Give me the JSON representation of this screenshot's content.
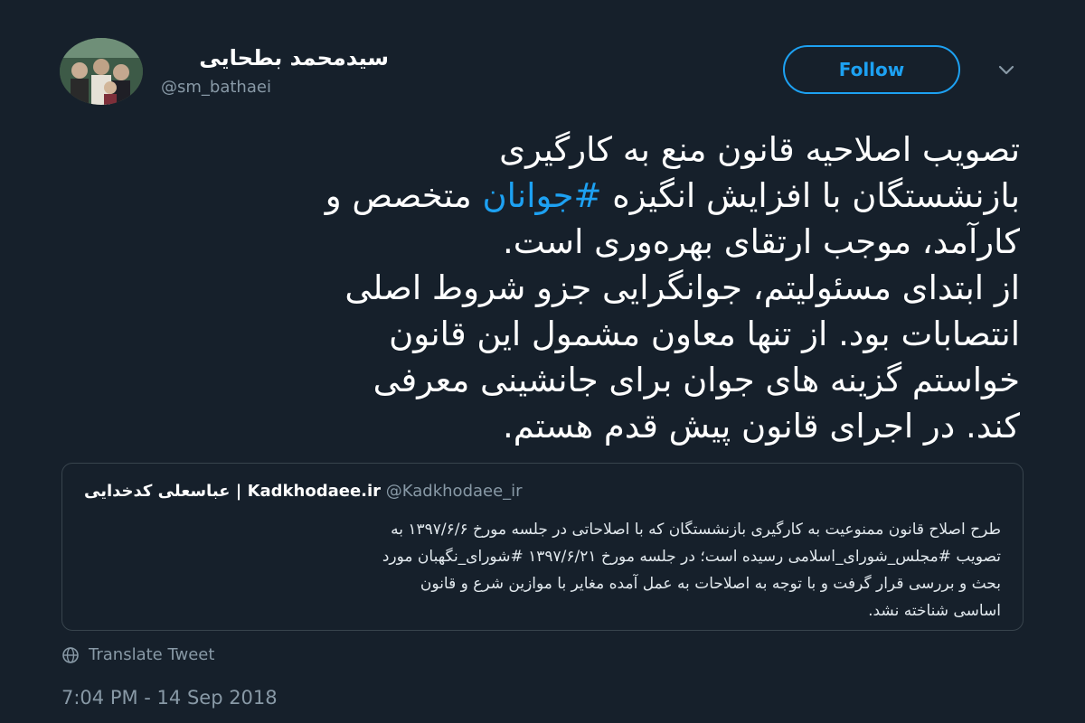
{
  "author": {
    "display_name": "سیدمحمد بطحایی",
    "handle": "@sm_bathaei"
  },
  "follow_label": "Follow",
  "tweet": {
    "lines": [
      "تصویب اصلاحیه قانون منع به کارگیری",
      {
        "before": "بازنشستگان با افزایش انگیزه ",
        "hashtag": "#جوانان",
        "after": " متخصص و"
      },
      "کارآمد، موجب ارتقای بهره‌وری است.",
      "از ابتدای مسئولیتم، جوانگرایی جزو شروط اصلی",
      "انتصابات بود. از تنها معاون مشمول این قانون",
      "خواستم گزینه های جوان برای جانشینی معرفی",
      "کند. در اجرای قانون پیش قدم هستم."
    ]
  },
  "quoted_tweet": {
    "name": "عباسعلی کدخدایی | Kadkhodaee.ir",
    "handle": "@Kadkhodaee_ir",
    "lines": [
      "طرح اصلاح قانون ممنوعیت به کارگیری بازنشستگان که با اصلاحاتی در جلسه مورخ ۱۳۹۷/۶/۶ به",
      "تصویب #مجلس_شورای_اسلامی رسیده است؛ در جلسه مورخ ۱۳۹۷/۶/۲۱ #شورای_نگهبان مورد",
      "بحث و بررسی قرار گرفت و با توجه به اصلاحات به عمل آمده مغایر با موازین شرع و قانون",
      "اساسی شناخته نشد."
    ]
  },
  "translate_label": "Translate Tweet",
  "timestamp": "7:04 PM - 14 Sep 2018",
  "colors": {
    "background": "#16202b",
    "accent": "#1da1f2",
    "muted": "#8899a6",
    "border": "#38444d"
  },
  "icons": {
    "chevron": "chevron-down-icon",
    "translate": "globe-icon"
  }
}
